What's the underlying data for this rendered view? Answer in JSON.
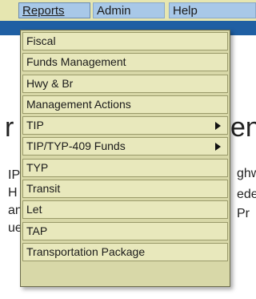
{
  "menubar": {
    "items": [
      {
        "label": "Reports"
      },
      {
        "label": "Admin"
      },
      {
        "label": "Help"
      }
    ]
  },
  "background": {
    "left_big": "r",
    "left_lines": [
      "IP",
      "H",
      "an",
      "ue"
    ],
    "right_big": "en",
    "right_lines": [
      "ghw",
      "ede",
      "Pr"
    ]
  },
  "reports_menu": {
    "items": [
      {
        "label": "Fiscal",
        "submenu": false
      },
      {
        "label": "Funds Management",
        "submenu": false
      },
      {
        "label": "Hwy & Br",
        "submenu": false
      },
      {
        "label": "Management Actions",
        "submenu": false
      },
      {
        "label": "TIP",
        "submenu": true
      },
      {
        "label": "TIP/TYP-409 Funds",
        "submenu": true
      },
      {
        "label": "TYP",
        "submenu": false
      },
      {
        "label": "Transit",
        "submenu": false
      },
      {
        "label": "Let",
        "submenu": false
      },
      {
        "label": "TAP",
        "submenu": false
      },
      {
        "label": "Transportation Package",
        "submenu": false
      }
    ]
  }
}
